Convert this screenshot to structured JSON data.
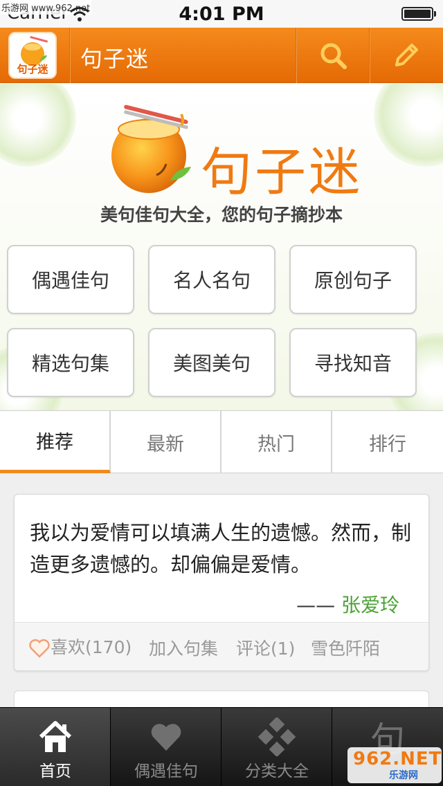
{
  "status_bar": {
    "carrier": "Carrier",
    "watermark": "乐游网 www.962.net",
    "time": "4:01 PM"
  },
  "navbar": {
    "logo_text": "句子迷",
    "title": "句子迷",
    "search_icon": "search-icon",
    "edit_icon": "pencil-icon",
    "accent_color": "#f07a12"
  },
  "hero": {
    "logo_text": "句子迷",
    "tagline": "美句佳句大全，您的句子摘抄本",
    "categories": [
      "偶遇佳句",
      "名人名句",
      "原创句子",
      "精选句集",
      "美图美句",
      "寻找知音"
    ]
  },
  "tabs": [
    "推荐",
    "最新",
    "热门",
    "排行"
  ],
  "card": {
    "text": "我以为爱情可以填满人生的遗憾。然而，制造更多遗憾的。却偏偏是爱情。",
    "dash": "——",
    "author": "张爱玲",
    "like": "喜欢(170)",
    "add_collection": "加入句集",
    "comment": "评论(1)",
    "user": "雪色阡陌"
  },
  "tabbar": {
    "items": [
      {
        "label": "首页",
        "icon": "home-icon"
      },
      {
        "label": "偶遇佳句",
        "icon": "heart-icon"
      },
      {
        "label": "分类大全",
        "icon": "category-icon"
      },
      {
        "label": "",
        "icon": "ju-glyph-icon"
      }
    ],
    "ju_glyph": "句"
  },
  "watermark_br": {
    "big": "962.NET",
    "small": "乐游网"
  }
}
